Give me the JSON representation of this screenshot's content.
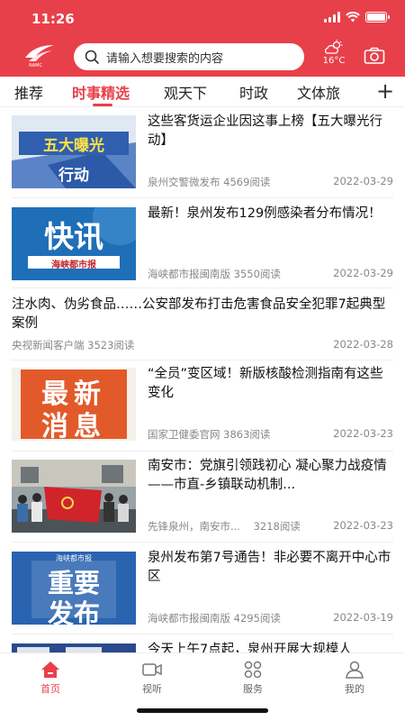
{
  "status_bar": {
    "time": "11:26"
  },
  "header": {
    "search_placeholder": "请输入想要搜索的内容",
    "weather_temp": "16°C",
    "logo_text": "NAMC"
  },
  "tabs": [
    {
      "label": "推荐"
    },
    {
      "label": "时事精选"
    },
    {
      "label": "观天下"
    },
    {
      "label": "时政"
    },
    {
      "label": "文体旅"
    }
  ],
  "articles": [
    {
      "title": "这些客货运企业因这事上榜【五大曝光行动】",
      "source": "泉州交警微发布",
      "reads": "4569阅读",
      "date": "2022-03-29",
      "thumb_text_1": "五大曝光",
      "thumb_text_2": "行动"
    },
    {
      "title": "最新！泉州发布129例感染者分布情况！",
      "source": "海峡都市报闽南版",
      "reads": "3550阅读",
      "date": "2022-03-29",
      "thumb_text_1": "快讯",
      "thumb_text_2": "海峡都市报"
    },
    {
      "title": "注水肉、伪劣食品……公安部发布打击危害食品安全犯罪7起典型案例",
      "source": "央视新闻客户端",
      "reads": "3523阅读",
      "date": "2022-03-28"
    },
    {
      "title": "“全员”变区域！新版核酸检测指南有这些变化",
      "source": "国家卫健委官网",
      "reads": "3863阅读",
      "date": "2022-03-23",
      "thumb_text_1": "最新",
      "thumb_text_2": "消息"
    },
    {
      "title": "南安市：党旗引领践初心 凝心聚力战疫情——市直-乡镇联动机制...",
      "source": "先锋泉州，南安市...",
      "reads": "3218阅读",
      "date": "2022-03-23"
    },
    {
      "title": "泉州发布第7号通告！非必要不离开中心市区",
      "source": "海峡都市报闽南版",
      "reads": "4295阅读",
      "date": "2022-03-19",
      "thumb_text_1": "重要",
      "thumb_text_2": "发布",
      "thumb_text_3": "海峡都市报"
    },
    {
      "title": "今天上午7点起，泉州开展大规模人",
      "source": "",
      "reads": "",
      "date": ""
    }
  ],
  "bottom_nav": [
    {
      "label": "首页"
    },
    {
      "label": "视听"
    },
    {
      "label": "服务"
    },
    {
      "label": "我的"
    }
  ],
  "colors": {
    "brand": "#e8404a",
    "meta": "#888888"
  }
}
